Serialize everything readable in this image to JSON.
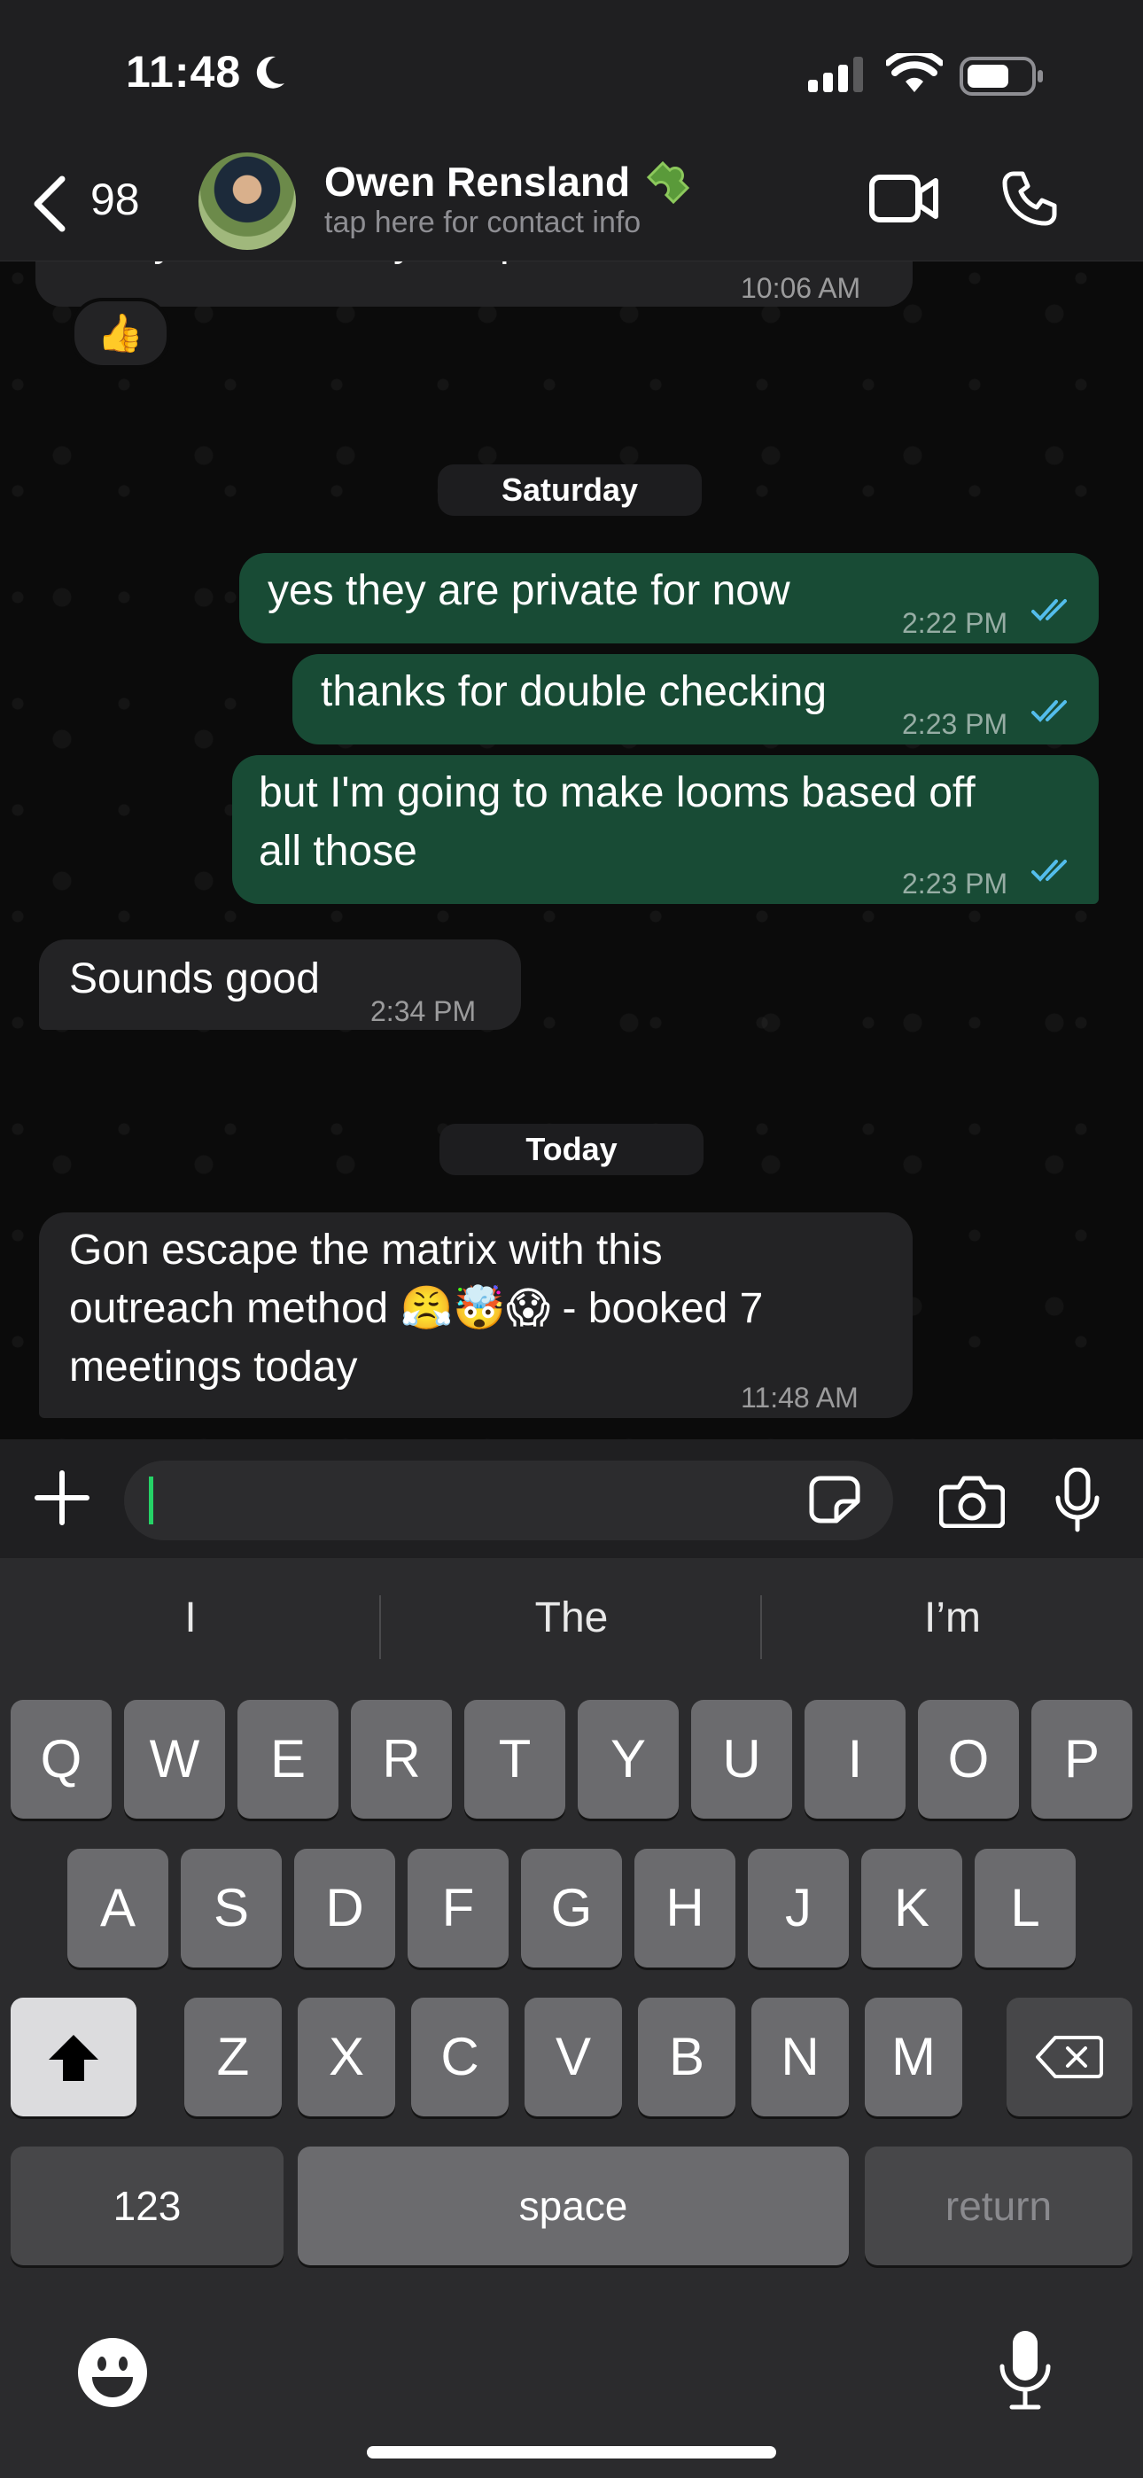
{
  "status": {
    "time": "11:48"
  },
  "header": {
    "back_count": "98",
    "contact_name": "Owen Rensland",
    "contact_subtitle": "tap here for contact info"
  },
  "chat": {
    "partial_message": {
      "text": "everyone, i'm they are private",
      "time": "10:06 AM",
      "reaction": "👍"
    },
    "date_saturday": "Saturday",
    "messages_saturday": [
      {
        "text": "yes they are private for now",
        "time": "2:22 PM"
      },
      {
        "text": "thanks for double checking",
        "time": "2:23 PM"
      },
      {
        "text_line1": "but I'm going to make looms based off",
        "text_line2": "all those",
        "time": "2:23 PM"
      }
    ],
    "incoming_saturday": {
      "text": "Sounds good",
      "time": "2:34 PM"
    },
    "date_today": "Today",
    "incoming_today": {
      "line1": "Gon escape the matrix with this",
      "line2": "outreach method 😤🤯😱 - booked 7",
      "line3": "meetings today",
      "time": "11:48 AM"
    }
  },
  "composer": {
    "input_value": "",
    "icons": [
      "plus-icon",
      "sticker-icon",
      "camera-icon",
      "microphone-icon"
    ]
  },
  "keyboard": {
    "suggestions": [
      "I",
      "The",
      "I’m"
    ],
    "row1": [
      "Q",
      "W",
      "E",
      "R",
      "T",
      "Y",
      "U",
      "I",
      "O",
      "P"
    ],
    "row2": [
      "A",
      "S",
      "D",
      "F",
      "G",
      "H",
      "J",
      "K",
      "L"
    ],
    "row3": [
      "Z",
      "X",
      "C",
      "V",
      "B",
      "N",
      "M"
    ],
    "numbers_key": "123",
    "space_key": "space",
    "return_key": "return"
  },
  "colors": {
    "outgoing_bubble": "#184b35",
    "incoming_bubble": "#232325",
    "read_ticks": "#53bdeb",
    "caret": "#25d366"
  }
}
